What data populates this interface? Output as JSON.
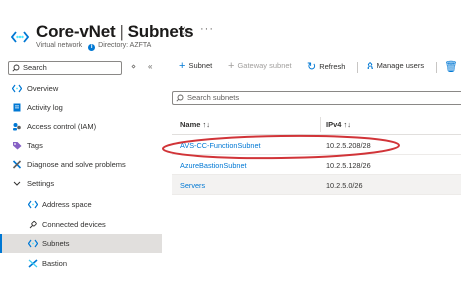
{
  "header": {
    "resource_name": "Core-vNet",
    "page_name": "Subnets",
    "resource_type": "Virtual network",
    "directory_label": "Directory: AZFTA",
    "icons": {
      "resource": "vnet-icon",
      "favorite": "star-icon",
      "more": "more-icon",
      "info": "info-icon"
    }
  },
  "sidebar": {
    "search_placeholder": "Search",
    "items": [
      {
        "label": "Overview",
        "icon": "vnet-icon",
        "indent": false,
        "active": false
      },
      {
        "label": "Activity log",
        "icon": "activity-log-icon",
        "indent": false,
        "active": false
      },
      {
        "label": "Access control (IAM)",
        "icon": "iam-icon",
        "indent": false,
        "active": false
      },
      {
        "label": "Tags",
        "icon": "tag-icon",
        "indent": false,
        "active": false
      },
      {
        "label": "Diagnose and solve problems",
        "icon": "wrench-icon",
        "indent": false,
        "active": false
      },
      {
        "label": "Settings",
        "icon": "chevron-down-icon",
        "indent": false,
        "active": false
      },
      {
        "label": "Address space",
        "icon": "vnet-icon",
        "indent": true,
        "active": false
      },
      {
        "label": "Connected devices",
        "icon": "plug-icon",
        "indent": true,
        "active": false
      },
      {
        "label": "Subnets",
        "icon": "vnet-icon",
        "indent": true,
        "active": true
      },
      {
        "label": "Bastion",
        "icon": "bastion-icon",
        "indent": true,
        "active": false
      }
    ]
  },
  "toolbar": {
    "subnet_label": "Subnet",
    "gateway_subnet_label": "Gateway subnet",
    "refresh_label": "Refresh",
    "manage_users_label": "Manage users"
  },
  "filter": {
    "placeholder": "Search subnets"
  },
  "table": {
    "columns": [
      "Name ↑↓",
      "IPv4 ↑↓"
    ],
    "rows": [
      {
        "name": "AVS-CC-FunctionSubnet",
        "ipv4": "10.2.5.208/28",
        "highlighted": false
      },
      {
        "name": "AzureBastionSubnet",
        "ipv4": "10.2.5.128/26",
        "highlighted": false
      },
      {
        "name": "Servers",
        "ipv4": "10.2.5.0/26",
        "highlighted": true
      }
    ]
  },
  "colors": {
    "accent": "#0078d4",
    "annotation": "#d13438",
    "active_bg": "#e1dfdd"
  }
}
